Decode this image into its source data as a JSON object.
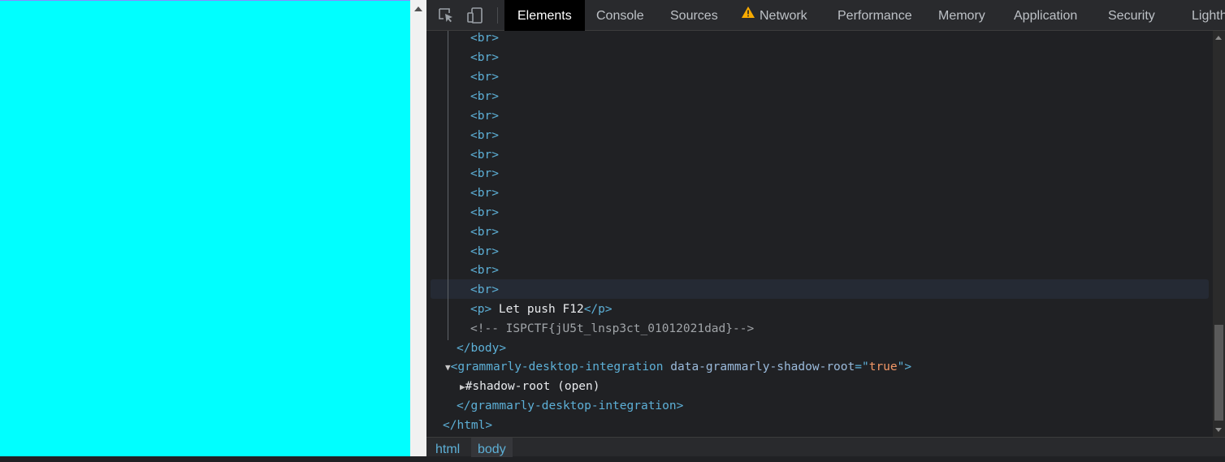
{
  "toolbar": {
    "icons": [
      "inspect-element-icon",
      "device-toolbar-icon"
    ],
    "tabs": [
      {
        "label": "Elements"
      },
      {
        "label": "Console"
      },
      {
        "label": "Sources"
      },
      {
        "label": "Network",
        "icon": "warning-icon"
      },
      {
        "label": "Performance"
      },
      {
        "label": "Memory"
      },
      {
        "label": "Application"
      },
      {
        "label": "Security"
      },
      {
        "label": "Lighth"
      }
    ]
  },
  "elements": {
    "br_tag": "<br>",
    "p_open": "<p>",
    "p_text": " Let push F12",
    "p_close": "</p>",
    "comment": "<!-- ISPCTF{jU5t_lnsp3ct_01012021dad}-->",
    "body_close": "</body>",
    "gdi_open": "<grammarly-desktop-integration",
    "gdi_attr_name": "data-grammarly-shadow-root",
    "gdi_attr_eq": "=\"",
    "gdi_attr_value": "true",
    "gdi_attr_close": "\">",
    "shadow_root": "#shadow-root (open)",
    "gdi_close": "</grammarly-desktop-integration>",
    "html_close": "</html>"
  },
  "breadcrumbs": [
    {
      "label": "html"
    },
    {
      "label": "body"
    }
  ],
  "colors": {
    "page_background": "#00ffff",
    "devtools_background": "#202124",
    "tag": "#5db0d7",
    "attribute_value": "#f29766",
    "warning": "#f9ab00"
  }
}
